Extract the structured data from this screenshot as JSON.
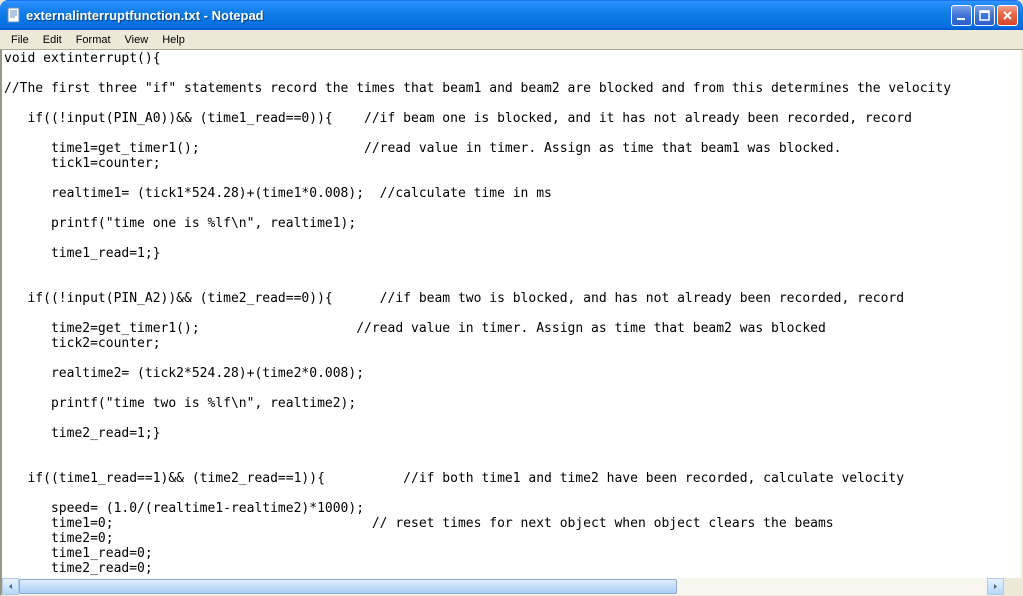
{
  "window": {
    "title": "externalinterruptfunction.txt - Notepad"
  },
  "menu": {
    "file": "File",
    "edit": "Edit",
    "format": "Format",
    "view": "View",
    "help": "Help"
  },
  "editor": {
    "content": "void extinterrupt(){\n\n//The first three \"if\" statements record the times that beam1 and beam2 are blocked and from this determines the velocity\n\n   if((!input(PIN_A0))&& (time1_read==0)){    //if beam one is blocked, and it has not already been recorded, record\n\n      time1=get_timer1();                     //read value in timer. Assign as time that beam1 was blocked.\n      tick1=counter;\n\n      realtime1= (tick1*524.28)+(time1*0.008);  //calculate time in ms\n\n      printf(\"time one is %lf\\n\", realtime1);\n\n      time1_read=1;}\n\n\n   if((!input(PIN_A2))&& (time2_read==0)){      //if beam two is blocked, and has not already been recorded, record\n\n      time2=get_timer1();                    //read value in timer. Assign as time that beam2 was blocked\n      tick2=counter;\n\n      realtime2= (tick2*524.28)+(time2*0.008);\n\n      printf(\"time two is %lf\\n\", realtime2);\n\n      time2_read=1;}\n\n\n   if((time1_read==1)&& (time2_read==1)){          //if both time1 and time2 have been recorded, calculate velocity\n\n      speed= (1.0/(realtime1-realtime2)*1000);\n      time1=0;                                 // reset times for next object when object clears the beams\n      time2=0;\n      time1_read=0;\n      time2_read=0;\n      printf(\"speed is %lf\\n,\" speed);}\n\n}//ext_int"
  }
}
